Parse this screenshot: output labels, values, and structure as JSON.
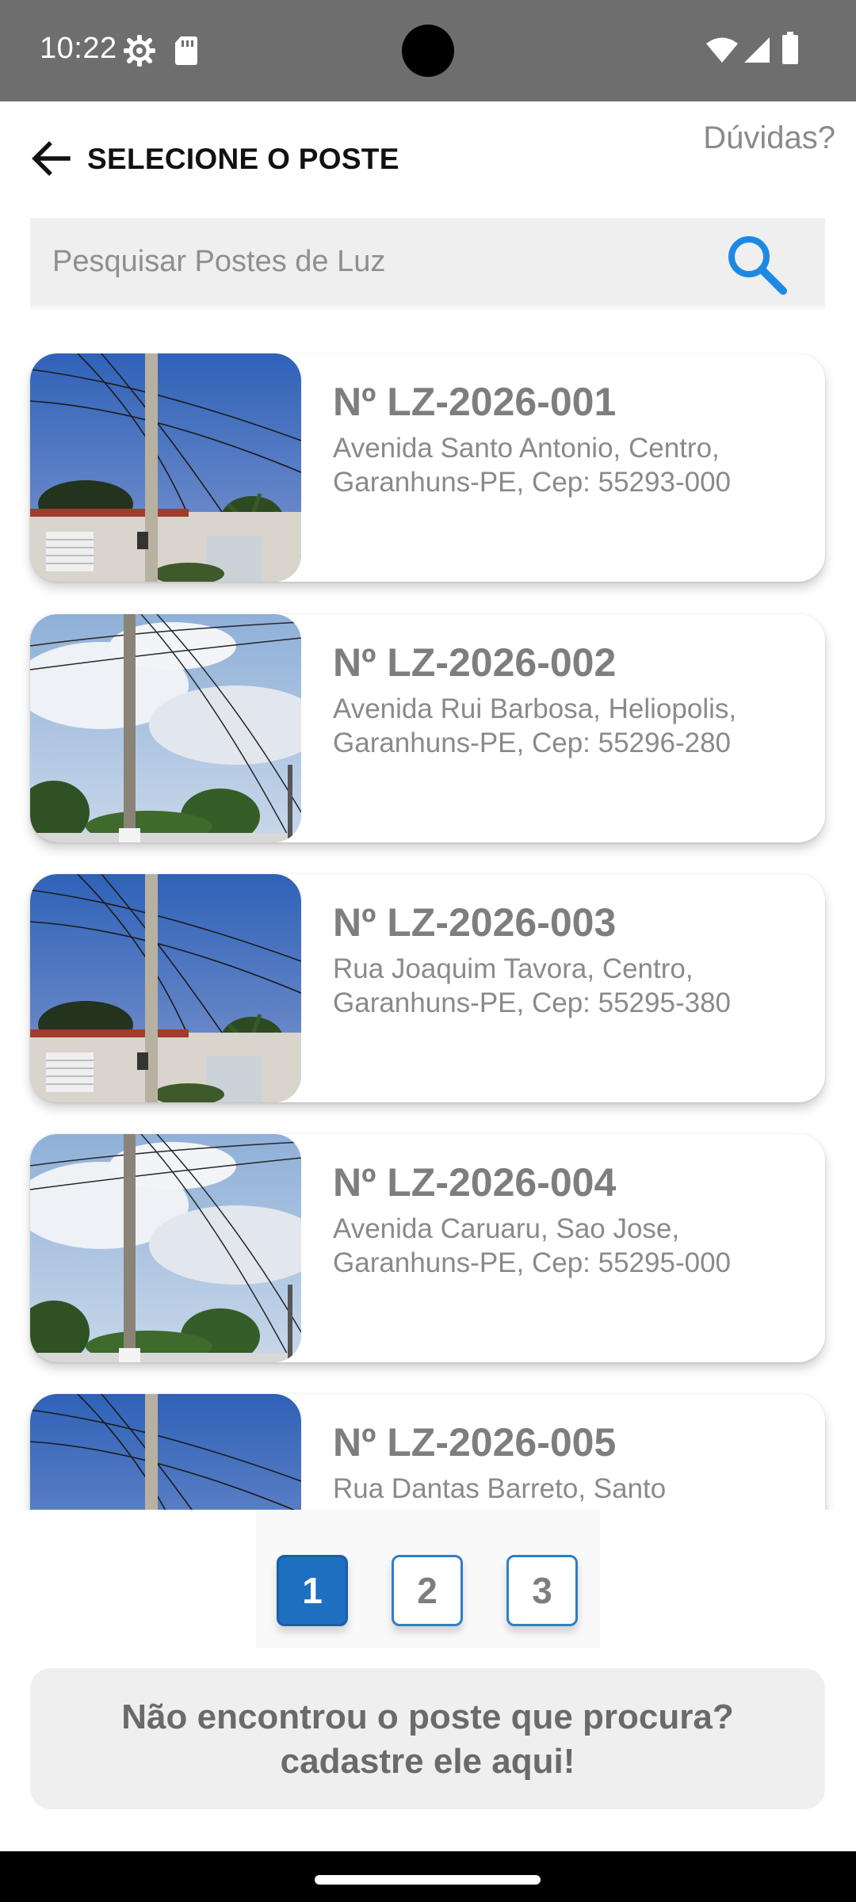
{
  "status_bar": {
    "time": "10:22",
    "icons": [
      "settings-gear-icon",
      "sd-card-icon",
      "wifi-icon",
      "signal-icon",
      "battery-icon"
    ]
  },
  "header": {
    "title": "SELECIONE O POSTE",
    "help_link": "Dúvidas?",
    "back_icon": "arrow-left-icon"
  },
  "search": {
    "placeholder": "Pesquisar Postes de Luz",
    "value": "",
    "icon": "search-icon",
    "icon_color": "#1e88e5"
  },
  "poles": [
    {
      "id": "Nº LZ-2026-001",
      "address": "Avenida Santo Antonio, Centro, Garanhuns-PE, Cep: 55293-000",
      "photo": "deep-blue-sky-pole-photo"
    },
    {
      "id": "Nº LZ-2026-002",
      "address": "Avenida Rui Barbosa, Heliopolis, Garanhuns-PE, Cep: 55296-280",
      "photo": "cloudy-sky-pole-photo"
    },
    {
      "id": "Nº LZ-2026-003",
      "address": "Rua Joaquim Tavora, Centro, Garanhuns-PE, Cep: 55295-380",
      "photo": "deep-blue-sky-pole-photo"
    },
    {
      "id": "Nº LZ-2026-004",
      "address": "Avenida Caruaru, Sao Jose, Garanhuns-PE, Cep: 55295-000",
      "photo": "cloudy-sky-pole-photo"
    },
    {
      "id": "Nº LZ-2026-005",
      "address": "Rua Dantas Barreto, Santo",
      "photo": "deep-blue-sky-pole-photo"
    }
  ],
  "pagination": {
    "pages": [
      "1",
      "2",
      "3"
    ],
    "current": "1",
    "accent_color": "#1e6fc0"
  },
  "register": {
    "line1": "Não encontrou o poste que procura?",
    "line2": "cadastre ele aqui!"
  }
}
